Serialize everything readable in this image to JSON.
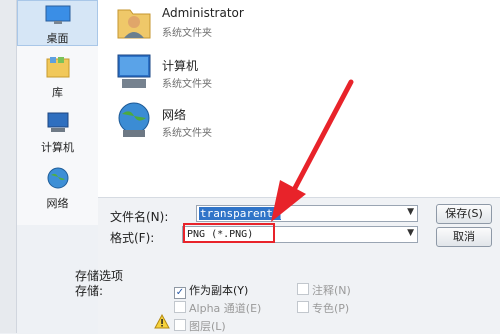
{
  "sidebar": {
    "items": [
      {
        "label": "桌面",
        "icon": "desktop-icon"
      },
      {
        "label": "库",
        "icon": "library-icon"
      },
      {
        "label": "计算机",
        "icon": "computer-icon"
      },
      {
        "label": "网络",
        "icon": "network-icon"
      }
    ]
  },
  "content": {
    "items": [
      {
        "name": "Administrator",
        "type": "系统文件夹",
        "icon": "user-folder-icon"
      },
      {
        "name": "计算机",
        "type": "系统文件夹",
        "icon": "computer-icon"
      },
      {
        "name": "网络",
        "type": "系统文件夹",
        "icon": "network-icon"
      }
    ]
  },
  "form": {
    "filename_label": "文件名(N):",
    "filename_value": "transparent.png",
    "format_label": "格式(F):",
    "format_value": "PNG (*.PNG)",
    "save_button": "保存(S)",
    "cancel_button": "取消"
  },
  "options": {
    "title": "存储选项",
    "store_label": "存储:",
    "as_copy": {
      "label": "作为副本(Y)",
      "checked": true
    },
    "notes": {
      "label": "注释(N)"
    },
    "alpha": {
      "label": "Alpha 通道(E)"
    },
    "spot": {
      "label": "专色(P)"
    },
    "layers": {
      "label": "图层(L)"
    }
  },
  "colors": {
    "highlight": "#e8232a",
    "selection": "#3074c8"
  }
}
